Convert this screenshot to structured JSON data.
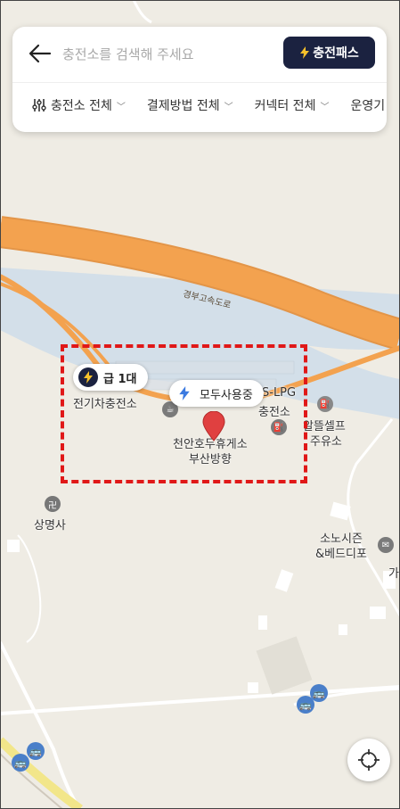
{
  "search": {
    "placeholder": "충전소를 검색해 주세요",
    "pass_button": "충전패스"
  },
  "filters": [
    {
      "label": "충전소 전체"
    },
    {
      "label": "결제방법 전체"
    },
    {
      "label": "커넥터 전체"
    },
    {
      "label": "운영기"
    }
  ],
  "map": {
    "road_label": "경부고속도로",
    "labels": {
      "ev_station": "전기차충전소",
      "lpg_station": "S-LPG",
      "charger_station": "충전소",
      "rest_area_line1": "천안호두휴게소",
      "rest_area_line2": "부산방향",
      "gas_station_line1": "알뜰셀프",
      "gas_station_line2": "주유소",
      "temple": "상명사",
      "shop_line1": "소노시즌",
      "shop_line2": "&베드디포",
      "edge_char": "가"
    },
    "fast_charger_badge": "급 1대",
    "public_badge": "모두사용중"
  },
  "colors": {
    "navy": "#1b2240",
    "bolt_yellow": "#f6c12c",
    "highway": "#f3a24f",
    "river": "#d3dfe9",
    "pin_red": "#e04040",
    "dash_red": "#e01818"
  }
}
